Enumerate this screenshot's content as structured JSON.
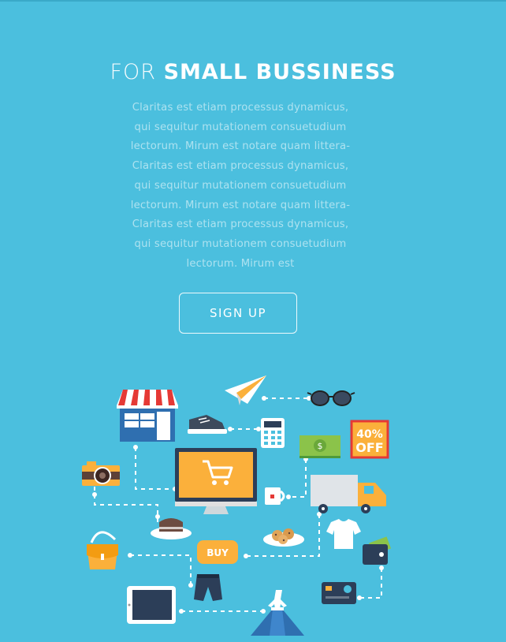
{
  "hero": {
    "title_light": "FOR",
    "title_bold": "SMALL BUSSINESS",
    "paragraph": "Claritas est etiam processus dynamicus, qui sequitur mutationem consuetudium lectorum. Mirum est notare quam littera- Claritas est etiam processus dynamicus, qui sequitur mutationem consuetudium lectorum. Mirum est notare quam littera- Claritas est etiam processus dynamicus, qui sequitur mutationem consuetudium lectorum.  Mirum  est",
    "cta_label": "SIGN UP"
  },
  "illustration": {
    "buy_label": "BUY",
    "discount_percent": "40%",
    "discount_off": "OFF",
    "dollar_sign": "$",
    "icons": [
      "shop-icon",
      "paper-plane-icon",
      "glasses-icon",
      "sneaker-icon",
      "calculator-icon",
      "banknote-icon",
      "discount-tag-icon",
      "camera-icon",
      "monitor-cart-icon",
      "mug-icon",
      "delivery-truck-icon",
      "cake-icon",
      "cookies-plate-icon",
      "tshirt-icon",
      "handbag-icon",
      "buy-tag-icon",
      "wallet-icon",
      "jeans-icon",
      "tablet-icon",
      "dress-icon",
      "credit-card-icon"
    ]
  },
  "colors": {
    "background": "#4bbfde",
    "accent_orange": "#fbb03b",
    "accent_red": "#e53935",
    "dark_navy": "#2c3e58"
  }
}
